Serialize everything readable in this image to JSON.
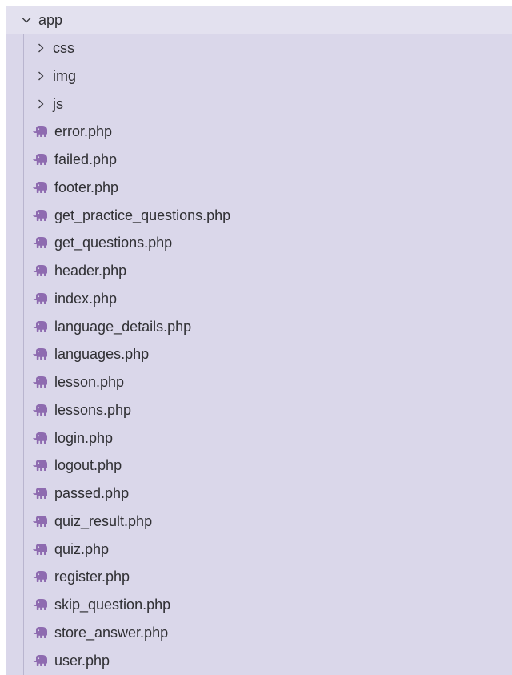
{
  "explorer": {
    "root": {
      "label": "app",
      "icon": "chevron-down-icon",
      "expanded": true
    },
    "folders": [
      {
        "label": "css",
        "icon": "chevron-right-icon"
      },
      {
        "label": "img",
        "icon": "chevron-right-icon"
      },
      {
        "label": "js",
        "icon": "chevron-right-icon"
      }
    ],
    "files": [
      {
        "label": "error.php",
        "icon": "php-elephant-icon"
      },
      {
        "label": "failed.php",
        "icon": "php-elephant-icon"
      },
      {
        "label": "footer.php",
        "icon": "php-elephant-icon"
      },
      {
        "label": "get_practice_questions.php",
        "icon": "php-elephant-icon"
      },
      {
        "label": "get_questions.php",
        "icon": "php-elephant-icon"
      },
      {
        "label": "header.php",
        "icon": "php-elephant-icon"
      },
      {
        "label": "index.php",
        "icon": "php-elephant-icon"
      },
      {
        "label": "language_details.php",
        "icon": "php-elephant-icon"
      },
      {
        "label": "languages.php",
        "icon": "php-elephant-icon"
      },
      {
        "label": "lesson.php",
        "icon": "php-elephant-icon"
      },
      {
        "label": "lessons.php",
        "icon": "php-elephant-icon"
      },
      {
        "label": "login.php",
        "icon": "php-elephant-icon"
      },
      {
        "label": "logout.php",
        "icon": "php-elephant-icon"
      },
      {
        "label": "passed.php",
        "icon": "php-elephant-icon"
      },
      {
        "label": "quiz_result.php",
        "icon": "php-elephant-icon"
      },
      {
        "label": "quiz.php",
        "icon": "php-elephant-icon"
      },
      {
        "label": "register.php",
        "icon": "php-elephant-icon"
      },
      {
        "label": "skip_question.php",
        "icon": "php-elephant-icon"
      },
      {
        "label": "store_answer.php",
        "icon": "php-elephant-icon"
      },
      {
        "label": "user.php",
        "icon": "php-elephant-icon"
      }
    ],
    "colors": {
      "panel_background": "#dad7ea",
      "root_row_background": "#e3e1ef",
      "text": "#2f2f33",
      "php_icon": "#8e6bb0"
    }
  }
}
